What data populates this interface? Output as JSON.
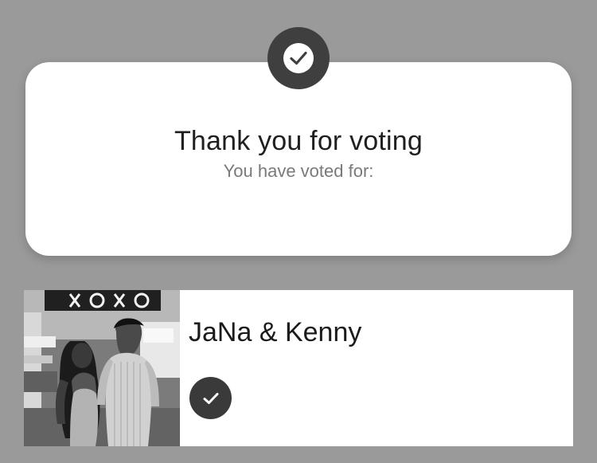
{
  "confirmation": {
    "title": "Thank you for voting",
    "subtitle": "You have voted for:",
    "icon": "check-circle-icon"
  },
  "vote": {
    "name": "JaNa & Kenny",
    "photo_alt": "JaNa & Kenny",
    "status_icon": "check-circle-icon"
  },
  "colors": {
    "background": "#9a9a9a",
    "card": "#ffffff",
    "icon_dark": "#3f3f3f",
    "title_text": "#1f1f1f",
    "subtitle_text": "#7a7a7a"
  }
}
